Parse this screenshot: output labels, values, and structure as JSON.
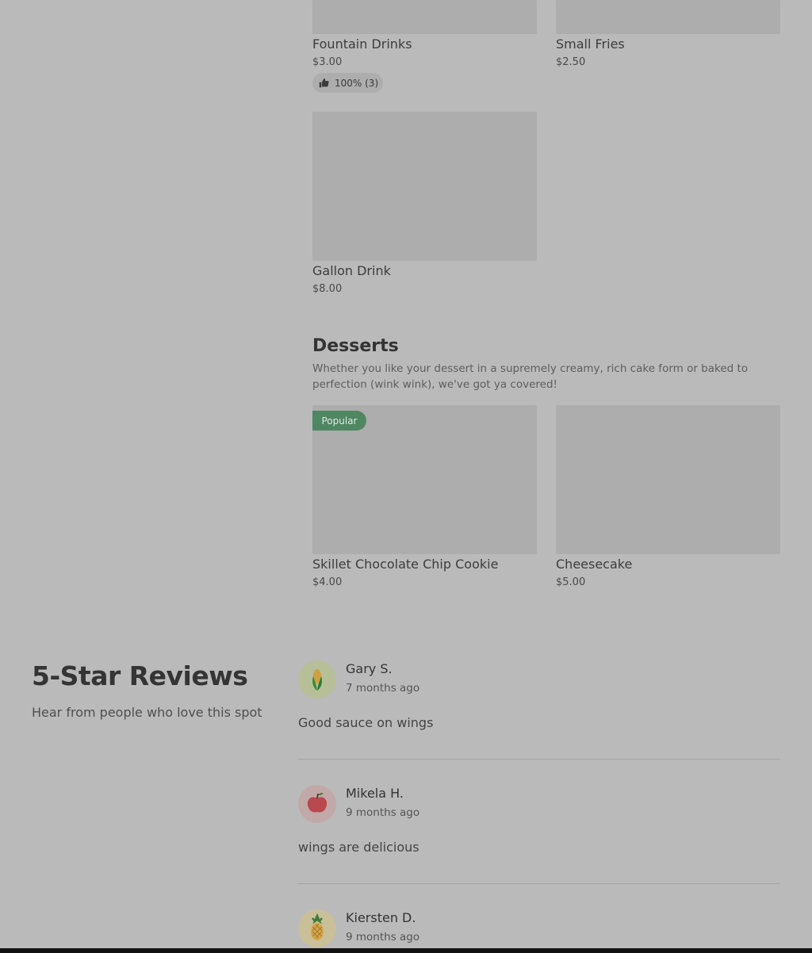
{
  "menu": {
    "items_top": [
      {
        "name": "Fountain Drinks",
        "price": "$3.00",
        "rating": "100% (3)"
      },
      {
        "name": "Small Fries",
        "price": "$2.50"
      },
      {
        "name": "Gallon Drink",
        "price": "$8.00"
      }
    ],
    "desserts": {
      "title": "Desserts",
      "description": "Whether you like your dessert in a supremely creamy, rich cake form or baked to perfection (wink wink), we've got ya covered!",
      "items": [
        {
          "name": "Skillet Chocolate Chip Cookie",
          "price": "$4.00",
          "badge": "Popular"
        },
        {
          "name": "Cheesecake",
          "price": "$5.00"
        }
      ]
    }
  },
  "reviews": {
    "title": "5-Star Reviews",
    "subtitle": "Hear from people who love this spot",
    "list": [
      {
        "name": "Gary S.",
        "time": "7 months ago",
        "text": "Good sauce on wings",
        "avatar_icon": "corn-icon",
        "avatar_bg": "#b7bf98"
      },
      {
        "name": "Mikela H.",
        "time": "9 months ago",
        "text": "wings are delicious",
        "avatar_icon": "apple-icon",
        "avatar_bg": "#c2a9a9"
      },
      {
        "name": "Kiersten D.",
        "time": "9 months ago",
        "text": "",
        "avatar_icon": "pineapple-icon",
        "avatar_bg": "#c9c09a"
      }
    ]
  },
  "colors": {
    "page_bg": "#bababa",
    "image_placeholder": "#adadad",
    "popular_badge": "#4e8762"
  }
}
